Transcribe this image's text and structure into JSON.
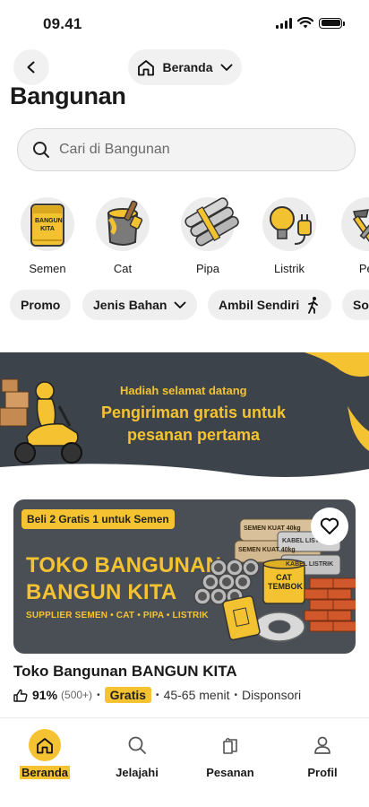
{
  "status_bar": {
    "time": "09.41"
  },
  "header": {
    "location_label": "Beranda",
    "page_title": "Bangunan"
  },
  "search": {
    "placeholder": "Cari di Bangunan"
  },
  "categories": [
    {
      "label": "Semen",
      "icon": "cement-bag-icon",
      "bag_text": "BANGUN KITA"
    },
    {
      "label": "Cat",
      "icon": "paint-bucket-icon"
    },
    {
      "label": "Pipa",
      "icon": "pipes-icon"
    },
    {
      "label": "Listrik",
      "icon": "lightbulb-plug-icon"
    },
    {
      "label": "Per",
      "icon": "tools-icon"
    }
  ],
  "filters": [
    {
      "label": "Promo"
    },
    {
      "label": "Jenis Bahan",
      "icon": "chevron-down-icon"
    },
    {
      "label": "Ambil Sendiri",
      "icon": "walking-person-icon"
    },
    {
      "label": "So"
    }
  ],
  "promo_banner": {
    "subtitle": "Hadiah selamat datang",
    "title": "Pengiriman gratis untuk pesanan pertama"
  },
  "store": {
    "badge": "Beli 2 Gratis 1 untuk Semen",
    "hero_line1": "TOKO BANGUNAN",
    "hero_line2": "BANGUN KITA",
    "hero_tagline": "SUPPLIER SEMEN • CAT • PIPA • LISTRIK",
    "name": "Toko Bangunan BANGUN KITA",
    "rating": "91%",
    "rating_count": "(500+)",
    "delivery": "Gratis",
    "eta": "45-65 menit",
    "sponsored": "Disponsori",
    "image_labels": {
      "bag1": "SEMEN KUAT 40kg",
      "bag2": "SEMEN KUAT 40kg",
      "cable1": "KABEL LISTRIK",
      "cable2": "KABEL LISTRIK",
      "paint": "CAT TEMBOK"
    }
  },
  "bottom_nav": [
    {
      "label": "Beranda",
      "icon": "home-icon",
      "active": true
    },
    {
      "label": "Jelajahi",
      "icon": "search-icon"
    },
    {
      "label": "Pesanan",
      "icon": "bags-icon"
    },
    {
      "label": "Profil",
      "icon": "person-icon"
    }
  ],
  "colors": {
    "accent": "#f5c331",
    "banner_bg": "#3d434b",
    "chip_bg": "#efefef"
  }
}
